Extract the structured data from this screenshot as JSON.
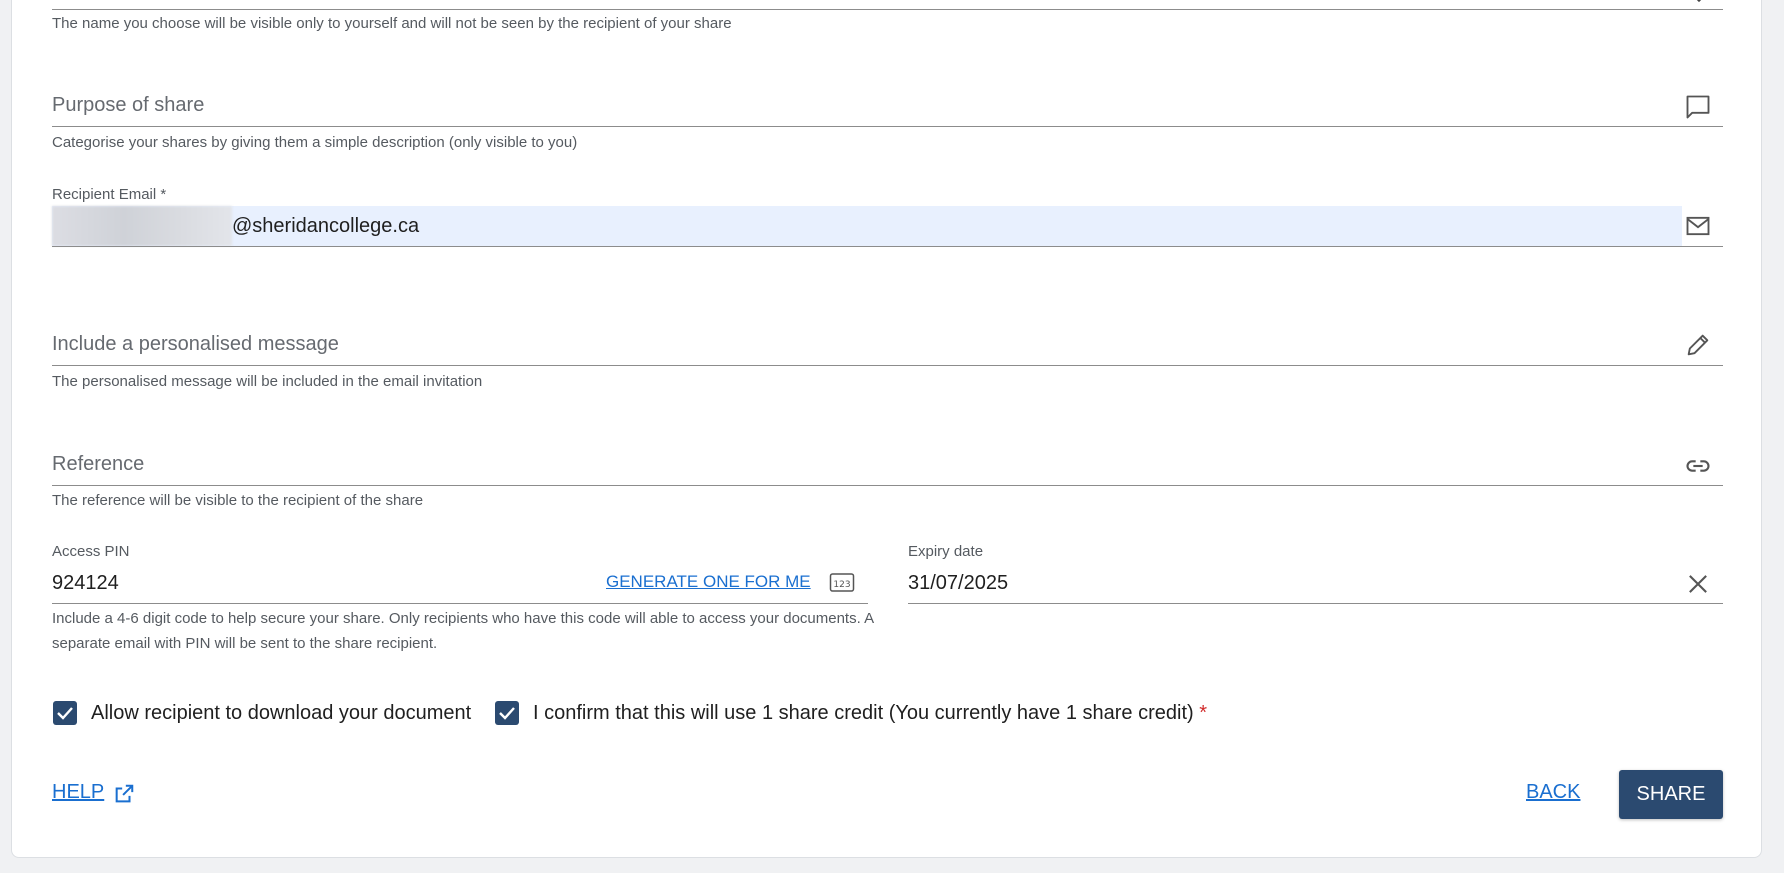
{
  "name_field": {
    "helper": "The name you choose will be visible only to yourself and will not be seen by the recipient of your share"
  },
  "purpose": {
    "placeholder": "Purpose of share",
    "helper": "Categorise your shares by giving them a simple description (only visible to you)",
    "icon": "comment-icon"
  },
  "recipient_email": {
    "label": "Recipient Email *",
    "value_domain": "@sheridancollege.ca",
    "icon": "mail-icon"
  },
  "message": {
    "placeholder": "Include a personalised message",
    "helper": "The personalised message will be included in the email invitation",
    "icon": "pencil-icon"
  },
  "reference": {
    "placeholder": "Reference",
    "helper": "The reference will be visible to the recipient of the share",
    "icon": "link-icon"
  },
  "access_pin": {
    "label": "Access PIN",
    "value": "924124",
    "generate_label": "GENERATE ONE FOR ME",
    "icon": "numeric-123-icon",
    "helper_line1": "Include a 4-6 digit code to help secure your share. Only recipients who have this code will able to access your documents. A",
    "helper_line2": "separate email with PIN will be sent to the share recipient."
  },
  "expiry": {
    "label": "Expiry date",
    "value": "31/07/2025",
    "icon": "close-icon"
  },
  "checkboxes": {
    "allow_download": "Allow recipient to download your document",
    "confirm_credit": "I confirm that this will use 1 share credit (You currently have 1 share credit)",
    "required_mark": "*"
  },
  "footer": {
    "help_label": "HELP",
    "back_label": "BACK",
    "share_label": "SHARE"
  },
  "colors": {
    "primary": "#2b4a70",
    "link": "#1a6fd0",
    "autofill": "#e8f0fe"
  }
}
